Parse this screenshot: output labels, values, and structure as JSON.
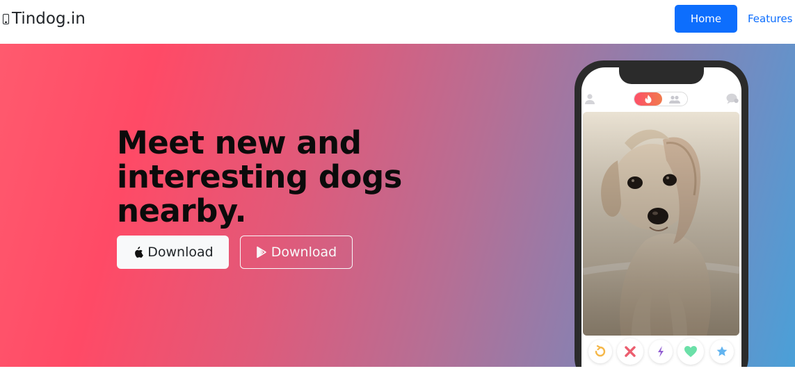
{
  "navbar": {
    "brand": "Tindog.in",
    "brand_icon": "mobile-phone-icon",
    "links": [
      {
        "label": "Home",
        "active": true
      },
      {
        "label": "Features",
        "active": false
      }
    ]
  },
  "hero": {
    "headline": "Meet new and interesting dogs nearby.",
    "buttons": [
      {
        "label": "Download",
        "icon": "apple-icon",
        "style": "light"
      },
      {
        "label": "Download",
        "icon": "google-play-icon",
        "style": "outline"
      }
    ]
  },
  "phone": {
    "image_subject": "dog photo card",
    "actions": [
      {
        "icon": "rewind-icon",
        "color": "#f5b748"
      },
      {
        "icon": "nope-icon",
        "color": "#ec5e6f"
      },
      {
        "icon": "boost-icon",
        "color": "#915dd1"
      },
      {
        "icon": "like-icon",
        "color": "#6be0a8"
      },
      {
        "icon": "super-like-icon",
        "color": "#62b4f0"
      }
    ]
  },
  "colors": {
    "primary": "#0d6efd",
    "gradient_start": "#ff4a66",
    "gradient_end": "#4aa0d8"
  }
}
